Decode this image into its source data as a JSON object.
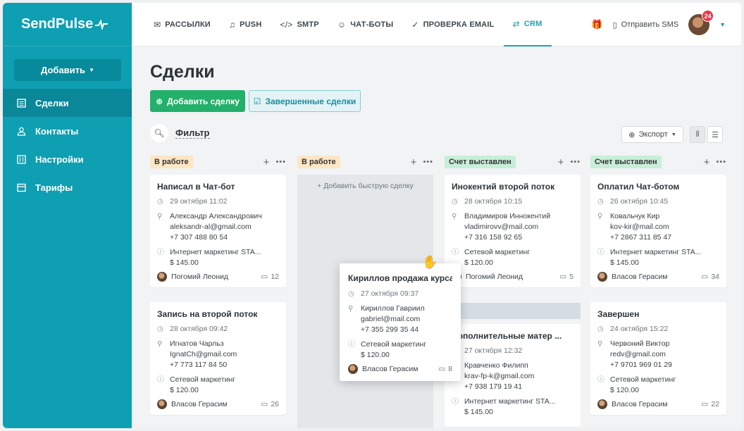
{
  "logo": {
    "text": "SendPulse",
    "mark": "⁄\\"
  },
  "sidebar": {
    "add_button": "Добавить",
    "items": [
      {
        "label": "Сделки",
        "icon": "deals-icon",
        "active": true
      },
      {
        "label": "Контакты",
        "icon": "contacts-icon",
        "active": false
      },
      {
        "label": "Настройки",
        "icon": "settings-icon",
        "active": false
      },
      {
        "label": "Тарифы",
        "icon": "tariffs-icon",
        "active": false
      }
    ]
  },
  "topbar": {
    "tabs": [
      {
        "label": "РАССЫЛКИ",
        "icon": "✉"
      },
      {
        "label": "PUSH",
        "icon": "🔔"
      },
      {
        "label": "SMTP",
        "icon": "</>"
      },
      {
        "label": "ЧАТ-БОТЫ",
        "icon": "☺"
      },
      {
        "label": "ПРОВЕРКА EMAIL",
        "icon": "✓"
      },
      {
        "label": "CRM",
        "icon": "⇄"
      }
    ],
    "send_sms": "Отправить SMS",
    "notifications": "24"
  },
  "main": {
    "title": "Сделки",
    "add_deal": "Добавить сделку",
    "completed_deals": "Завершенные сделки",
    "filter": "Фильтр",
    "export": "Экспорт"
  },
  "columns": [
    {
      "stage": "В работе"
    },
    {
      "stage": "В работе",
      "quick_add": "Добавить быструю сделку"
    },
    {
      "stage": "Счет выставлен"
    },
    {
      "stage": "Счет выставлен"
    }
  ],
  "cards": {
    "c1a": {
      "title": "Написал в Чат-бот",
      "date": "29 октября 11:02",
      "name": "Александр Александрович",
      "email": "aleksandr-al@gmail.com",
      "phone": "+7 307 488 80 54",
      "product": "Интернет маркетинг STA...",
      "price": "$ 145.00",
      "manager": "Погомий Леонид",
      "comments": "12"
    },
    "c1b": {
      "title": "Запись на второй поток",
      "date": "28 октября 09:42",
      "name": "Игнатов Чарльз",
      "email": "IgnatCh@gmail.com",
      "phone": "+7 773 117 84 50",
      "product": "Сетевой маркетинг",
      "price": "$ 120.00",
      "manager": "Власов Герасим",
      "comments": "26"
    },
    "c3a": {
      "title": "Инокентий второй поток",
      "date": "28 октября 10:15",
      "name": "Владимиров Иннокентий",
      "email": "vladimirovv@mail.com",
      "phone": "+7 316 158 92 65",
      "product": "Сетевой маркетинг",
      "price": "$ 120.00",
      "manager": "Погомий Леонид",
      "comments": "5"
    },
    "c3b": {
      "title": "Дополнительные матер ...",
      "date": "27 октября 12:32",
      "name": "Кравченко Филипп",
      "email": "krav-fp-k@gmail.com",
      "phone": "+7 938 179 19 41",
      "product": "Интернет маркетинг STA...",
      "price": "$ 145.00"
    },
    "c4a": {
      "title": "Оплатил Чат-ботом",
      "date": "26 октября 10:45",
      "name": "Ковальчук Кир",
      "email": "kov-kir@mail.com",
      "phone": "+7 2867 311 85 47",
      "product": "Интернет маркетинг STA...",
      "price": "$ 145.00",
      "manager": "Власов Герасим",
      "comments": "34"
    },
    "c4b": {
      "title": "Завершен",
      "date": "24 октября 15:22",
      "name": "Червоний Виктор",
      "email": "redv@gmail.com",
      "phone": "+7 9701 969 01 29",
      "product": "Сетевой маркетинг",
      "price": "$ 120.00",
      "manager": "Власов Герасим",
      "comments": "22"
    },
    "drag": {
      "title": "Кириллов продажа курса",
      "date": "27 октября 09:37",
      "name": "Кириллов Гавриил",
      "email": "gabriel@mail.com",
      "phone": "+7 355 299 35 44",
      "product": "Сетевой маркетинг",
      "price": "$ 120.00",
      "manager": "Власов Герасим",
      "comments": "8"
    }
  }
}
